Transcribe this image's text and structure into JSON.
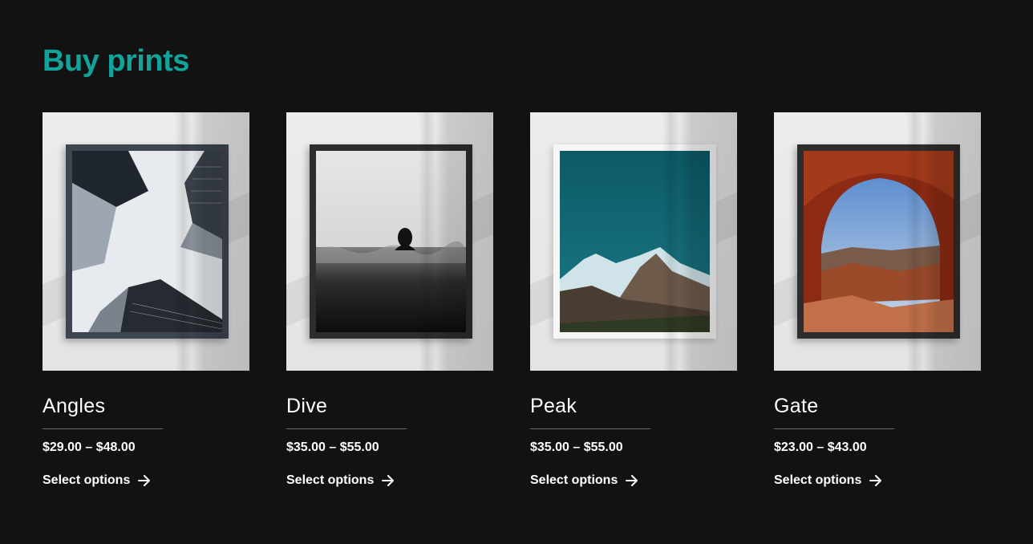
{
  "section": {
    "title": "Buy prints"
  },
  "colors": {
    "accent": "#12a39a",
    "background": "#121212"
  },
  "products": [
    {
      "name": "Angles",
      "price": "$29.00 – $48.00",
      "cta": "Select options",
      "cta_icon": "arrow-right-icon"
    },
    {
      "name": "Dive",
      "price": "$35.00 – $55.00",
      "cta": "Select options",
      "cta_icon": "arrow-right-icon"
    },
    {
      "name": "Peak",
      "price": "$35.00 – $55.00",
      "cta": "Select options",
      "cta_icon": "arrow-right-icon"
    },
    {
      "name": "Gate",
      "price": "$23.00 – $43.00",
      "cta": "Select options",
      "cta_icon": "arrow-right-icon"
    }
  ]
}
